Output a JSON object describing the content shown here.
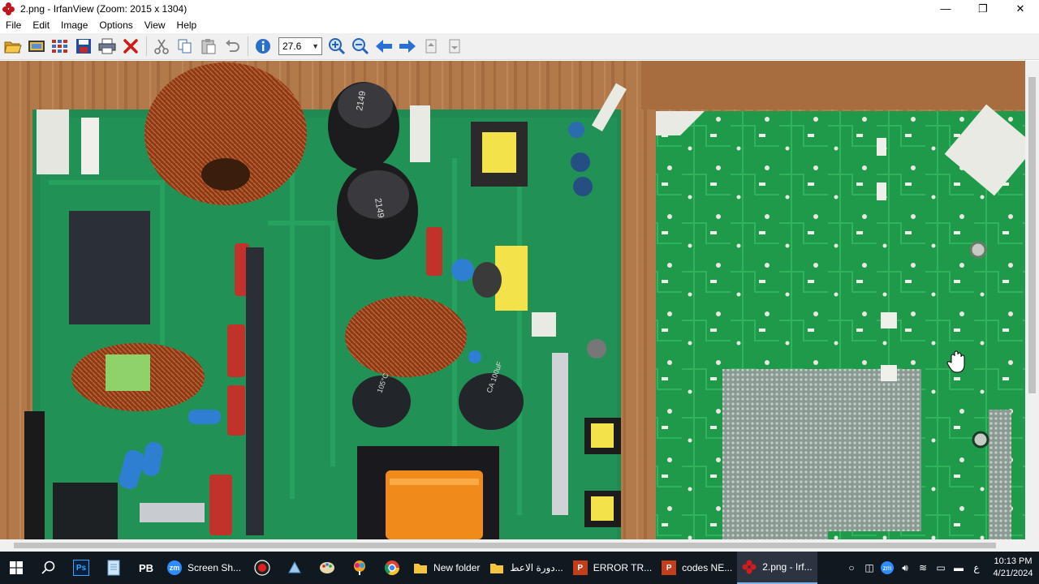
{
  "window": {
    "title": "2.png - IrfanView (Zoom: 2015 x 1304)",
    "minimize": "—",
    "restore": "❐",
    "close": "✕"
  },
  "menu": [
    "File",
    "Edit",
    "Image",
    "Options",
    "View",
    "Help"
  ],
  "toolbar": {
    "zoom_value": "27.6",
    "icons": [
      "open-icon",
      "slideshow-icon",
      "thumbnails-icon",
      "save-icon",
      "print-icon",
      "delete-icon",
      "cut-icon",
      "copy-icon",
      "paste-icon",
      "undo-icon",
      "info-icon",
      "zoom-in-icon",
      "zoom-out-icon",
      "previous-icon",
      "next-icon",
      "first-page-icon",
      "last-page-icon"
    ]
  },
  "image": {
    "capacitor_label_1": "2149",
    "capacitor_label_2": "2149",
    "capacitor_label_3": "105°C",
    "capacitor_label_4": "CA 100uF"
  },
  "taskbar": {
    "apps": [
      {
        "label": "Screen Sh...",
        "icon": "zm"
      },
      {
        "label": "New folder",
        "icon": "folder"
      },
      {
        "label": "دورة الاعط...",
        "icon": "folder"
      },
      {
        "label": "ERROR TR...",
        "icon": "P"
      },
      {
        "label": "codes NE...",
        "icon": "P"
      },
      {
        "label": "2.png - Irf...",
        "icon": "irfan"
      }
    ],
    "ps_label": "Ps",
    "pb_label": "PB",
    "lang": "ع",
    "time": "10:13 PM",
    "date": "4/21/2024"
  },
  "colors": {
    "pcb_green": "#1f8a4e",
    "pcb_green_right": "#1e9a47",
    "wood": "#b57a4c",
    "copper": "#8a3b18",
    "taskbar": "#101820"
  }
}
